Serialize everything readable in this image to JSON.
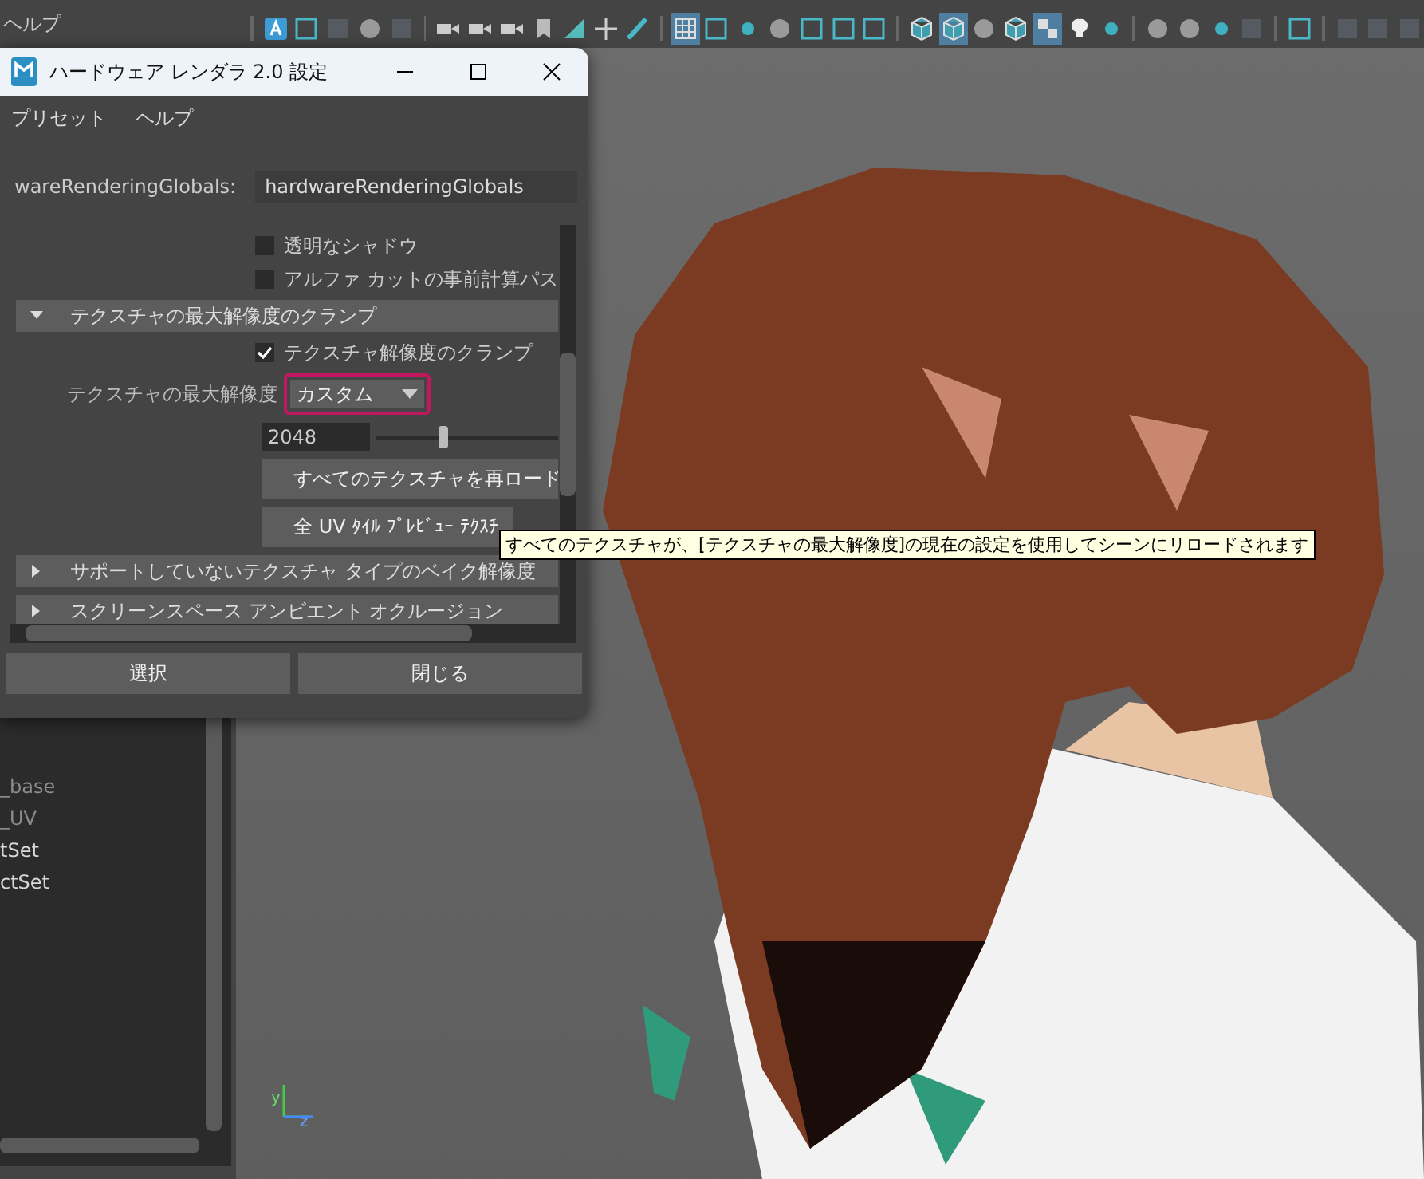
{
  "outliner": {
    "menu": "ヘルプ",
    "items": [
      {
        "label": "_base",
        "dimmed": true
      },
      {
        "label": "_UV",
        "dimmed": true
      },
      {
        "label": "tSet",
        "dimmed": false
      },
      {
        "label": "ctSet",
        "dimmed": false
      }
    ]
  },
  "toolbar": [
    {
      "kind": "sep"
    },
    {
      "kind": "letter-a",
      "selected": false
    },
    {
      "kind": "frame",
      "selected": false
    },
    {
      "kind": "square",
      "selected": false
    },
    {
      "kind": "circle",
      "selected": false
    },
    {
      "kind": "square",
      "selected": false
    },
    {
      "kind": "sep"
    },
    {
      "kind": "camera",
      "selected": false
    },
    {
      "kind": "camera",
      "selected": false
    },
    {
      "kind": "camera",
      "selected": false
    },
    {
      "kind": "bookmark",
      "selected": false
    },
    {
      "kind": "triangle",
      "selected": false
    },
    {
      "kind": "crosshair",
      "selected": false
    },
    {
      "kind": "brush",
      "selected": false
    },
    {
      "kind": "sep"
    },
    {
      "kind": "grid",
      "selected": true
    },
    {
      "kind": "frame",
      "selected": false
    },
    {
      "kind": "dot",
      "selected": false
    },
    {
      "kind": "circle",
      "selected": false
    },
    {
      "kind": "frame",
      "selected": false
    },
    {
      "kind": "frame",
      "selected": false
    },
    {
      "kind": "frame",
      "selected": false
    },
    {
      "kind": "sep"
    },
    {
      "kind": "cube",
      "selected": false
    },
    {
      "kind": "cube",
      "selected": true
    },
    {
      "kind": "circle",
      "selected": false
    },
    {
      "kind": "cube",
      "selected": false
    },
    {
      "kind": "checker",
      "selected": true
    },
    {
      "kind": "bulb",
      "selected": false
    },
    {
      "kind": "dot",
      "selected": false
    },
    {
      "kind": "sep"
    },
    {
      "kind": "circle",
      "selected": false
    },
    {
      "kind": "circle",
      "selected": false
    },
    {
      "kind": "dot",
      "selected": false
    },
    {
      "kind": "square",
      "selected": false
    },
    {
      "kind": "sep"
    },
    {
      "kind": "frame",
      "selected": false
    },
    {
      "kind": "sep"
    },
    {
      "kind": "square",
      "selected": false
    },
    {
      "kind": "square",
      "selected": false
    },
    {
      "kind": "square",
      "selected": false
    }
  ],
  "viewport": {
    "axis_labels": [
      "y",
      "z"
    ]
  },
  "dialog": {
    "title": "ハードウェア レンダラ 2.0 設定",
    "menu": [
      "プリセット",
      "ヘルプ"
    ],
    "node_label": "wareRenderingGlobals:",
    "node_value": "hardwareRenderingGlobals",
    "checkboxes": [
      {
        "label": "透明なシャドウ",
        "checked": false
      },
      {
        "label": "アルファ カットの事前計算パス",
        "checked": false
      }
    ],
    "section": {
      "title": "テクスチャの最大解像度のクランプ",
      "expanded": true,
      "clamp": {
        "label": "テクスチャ解像度のクランプ",
        "checked": true
      },
      "resolution_label": "テクスチャの最大解像度",
      "resolution_value": "カスタム",
      "highlighted": true,
      "size_value": "2048",
      "level": 0.34,
      "buttons": [
        "すべてのテクスチャを再ロード",
        "全 UV ﾀｲﾙ ﾌﾟﾚﾋﾞｭｰ ﾃｸｽﾁ"
      ]
    },
    "sections": [
      {
        "title": "サポートしていないテクスチャ タイプのベイク解像度",
        "expanded": false
      },
      {
        "title": "スクリーンスペース アンビエント オクルージョン",
        "expanded": false
      }
    ],
    "footer_buttons": [
      "選択",
      "閉じる"
    ]
  },
  "tooltip": "すべてのテクスチャが、[テクスチャの最大解像度]の現在の設定を使用してシーンにリロードされます"
}
